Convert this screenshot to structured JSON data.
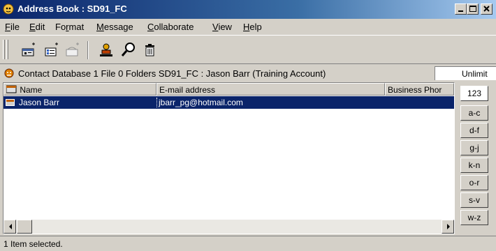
{
  "window": {
    "title": "Address Book : SD91_FC",
    "controls": [
      "minimize-icon",
      "maximize-icon",
      "close-icon"
    ]
  },
  "menu": {
    "items": [
      {
        "pre": "",
        "u": "F",
        "post": "ile"
      },
      {
        "pre": "",
        "u": "E",
        "post": "dit"
      },
      {
        "pre": "Fo",
        "u": "r",
        "post": "mat"
      },
      {
        "pre": "",
        "u": "M",
        "post": "essage"
      },
      {
        "pre": "",
        "u": "C",
        "post": "ollaborate"
      },
      {
        "pre": "",
        "u": "V",
        "post": "iew"
      },
      {
        "pre": "",
        "u": "H",
        "post": "elp"
      }
    ]
  },
  "toolbar": {
    "icons": [
      "new-contact-icon",
      "new-list-icon",
      "new-group-icon",
      "contact-card-icon",
      "find-icon",
      "delete-icon"
    ]
  },
  "info": {
    "text": "Contact Database   1 File  0 Folders   SD91_FC : Jason Barr (Training Account)",
    "right": "Unlimit"
  },
  "list": {
    "columns": [
      "Name",
      "E-mail address",
      "Business Phor"
    ],
    "rows": [
      {
        "name": "Jason Barr",
        "email": "jbarr_pg@hotmail.com",
        "phone": ""
      }
    ]
  },
  "index": [
    "123",
    "a-c",
    "d-f",
    "g-j",
    "k-n",
    "o-r",
    "s-v",
    "w-z"
  ],
  "status": {
    "text": "1 Item selected."
  },
  "colors": {
    "title_bar": "#0a246a",
    "selection": "#0a246a",
    "face": "#d4d0c8"
  }
}
